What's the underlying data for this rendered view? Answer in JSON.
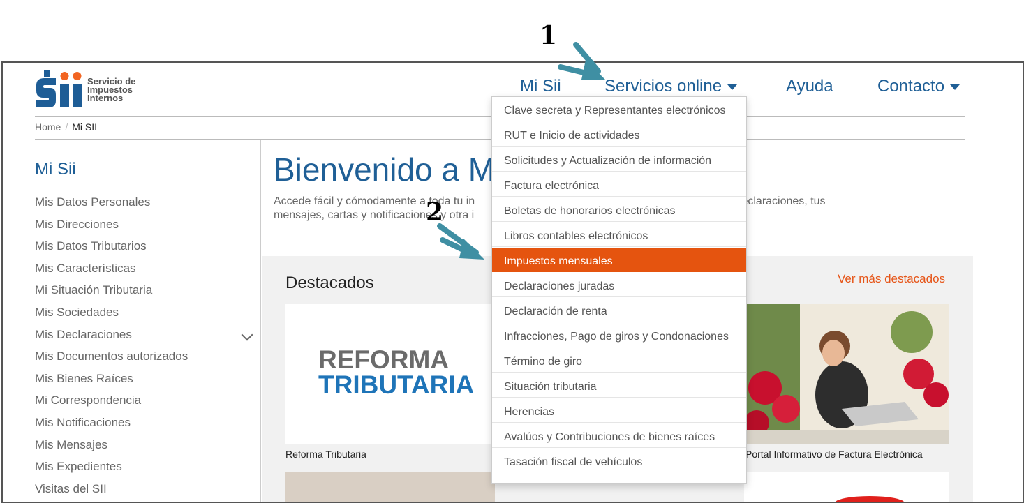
{
  "logo": {
    "line1": "Servicio de",
    "line2": "Impuestos",
    "line3": "Internos",
    "brand_blue": "#1e5d96",
    "brand_orange": "#f26522"
  },
  "nav": {
    "mi_sii": "Mi Sii",
    "servicios": "Servicios online",
    "ayuda": "Ayuda",
    "contacto": "Contacto"
  },
  "breadcrumb": {
    "home": "Home",
    "sep": "/",
    "current": "Mi SII"
  },
  "sidebar": {
    "title": "Mi Sii",
    "items": [
      "Mis Datos Personales",
      "Mis Direcciones",
      "Mis Datos Tributarios",
      "Mis Características",
      "Mi Situación Tributaria",
      "Mis Sociedades",
      "Mis Declaraciones",
      "Mis Documentos autorizados",
      "Mis Bienes Raíces",
      "Mi Correspondencia",
      "Mis Notificaciones",
      "Mis Mensajes",
      "Mis Expedientes",
      "Visitas del SII"
    ]
  },
  "main": {
    "title": "Bienvenido a M",
    "desc_line1": "Accede fácil y cómodamente a toda tu in",
    "desc_line1_right": ", estado de tus declaraciones, tus",
    "desc_line2": "mensajes, cartas y notificaciones y otra i",
    "destacados": "Destacados",
    "ver_mas": "Ver más destacados",
    "card1_label": "Reforma Tributaria",
    "card1_img_line1": "REFORMA",
    "card1_img_line2": "TRIBUTARIA",
    "card3_label": "Portal Informativo de Factura Electrónica"
  },
  "dropdown": {
    "items": [
      "Clave secreta y Representantes electrónicos",
      "RUT e Inicio de actividades",
      "Solicitudes y Actualización de información",
      "Factura electrónica",
      "Boletas de honorarios electrónicas",
      "Libros contables electrónicos",
      "Impuestos mensuales",
      "Declaraciones juradas",
      "Declaración de renta",
      "Infracciones, Pago de giros y Condonaciones",
      "Término de giro",
      "Situación tributaria",
      "Herencias",
      "Avalúos y Contribuciones de bienes raíces",
      "Tasación fiscal de vehículos"
    ],
    "active": "Impuestos mensuales",
    "active_color": "#e5540f"
  },
  "annotations": {
    "step1": "1",
    "step2": "2",
    "arrow_color": "#3f8fa3"
  }
}
